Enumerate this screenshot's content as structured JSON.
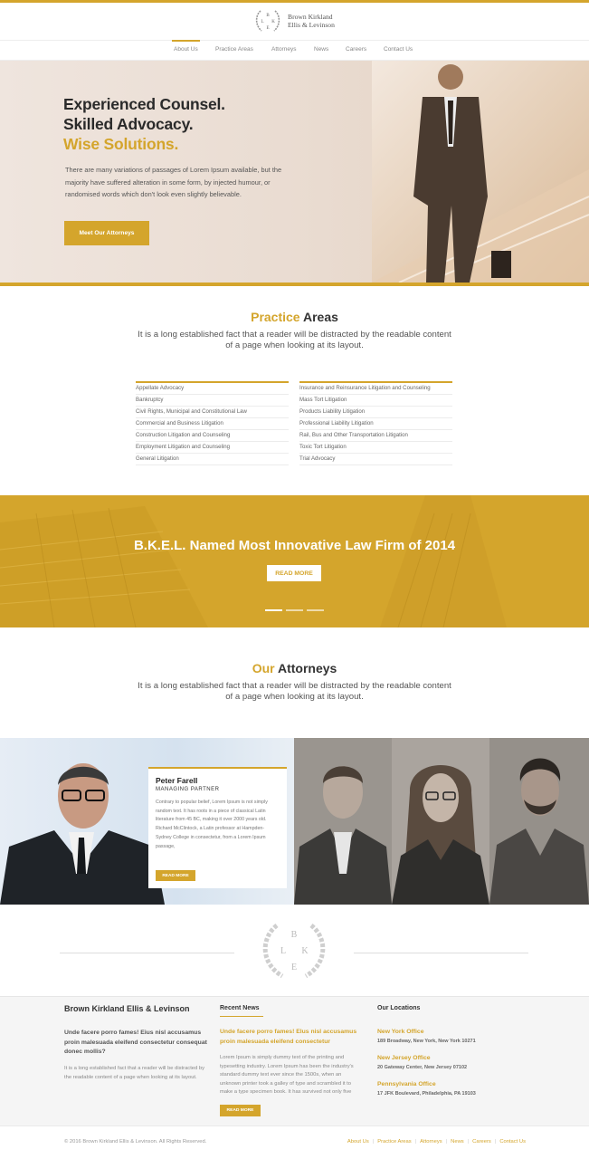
{
  "brand": {
    "name_line1": "Brown Kirkland",
    "name_line2": "Ellis & Levinson",
    "monogram": [
      "B",
      "L",
      "K",
      "E"
    ],
    "accent": "#d4a52c"
  },
  "nav": {
    "items": [
      "About Us",
      "Practice Areas",
      "Attorneys",
      "News",
      "Careers",
      "Contact Us"
    ],
    "active": "About Us"
  },
  "hero": {
    "line1": "Experienced Counsel.",
    "line2": "Skilled Advocacy.",
    "line3": "Wise Solutions.",
    "paragraph": "There are many variations of passages of Lorem Ipsum available, but the majority have suffered alteration in some form, by injected humour, or randomised words which don't look even slightly believable.",
    "button": "Meet Our Attorneys"
  },
  "practice": {
    "title_gold": "Practice",
    "title_rest": "Areas",
    "subtitle": "It is a long established fact that a reader will be distracted by the readable content of a page when looking at its layout.",
    "left": [
      "Appellate Advocacy",
      "Bankruptcy",
      "Civil Rights, Municipal and Constitutional Law",
      "Commercial and Business Litigation",
      "Construction Litigation and Counseling",
      "Employment Litigation and Counseling",
      "General Litigation"
    ],
    "right": [
      "Insurance and Reinsurance Litigation and Counseling",
      "Mass Tort Litigation",
      "Products Liability Litigation",
      "Professional Liability Litigation",
      "Rail, Bus and Other Transportation Litigation",
      "Toxic Tort Litigation",
      "Trial Advocacy"
    ]
  },
  "banner": {
    "title": "B.K.E.L. Named Most Innovative Law Firm of 2014",
    "button": "READ MORE"
  },
  "attorneys": {
    "title_gold": "Our",
    "title_rest": "Attorneys",
    "subtitle": "It is a long established fact that a reader will be distracted by the readable content of a page when looking at its layout.",
    "featured": {
      "name": "Peter Farell",
      "role": "MANAGING PARTNER",
      "bio": "Contrary to popular belief, Lorem Ipsum is not simply random text. It has roots in a piece of classical Latin literature from 45 BC, making it over 2000 years old. Richard McClintock, a Latin professor at Hampden-Sydney College in consectetur, from a Lorem Ipsum passage,",
      "button": "READ MORE"
    }
  },
  "footer": {
    "firm": {
      "heading": "Brown Kirkland Ellis & Levinson",
      "lead": "Unde facere porro fames! Eius nisl accusamus proin malesuada eleifend consectetur consequat donec mollis?",
      "text": "It is a long established fact that a reader will be distracted by the readable content of a page when looking at its layout."
    },
    "news": {
      "heading": "Recent News",
      "headline": "Unde facere porro fames! Elus nisl accusamus proin malesuada eleifend consectetur",
      "text": "Lorem Ipsum is simply dummy text of the printing and typesetting industry. Lorem Ipsum has been the industry's standard dummy text ever since the 1500s, when an unknown printer took a galley of type and scrambled it to make a type specimen book. It has survived not only five",
      "button": "READ MORE"
    },
    "locations": {
      "heading": "Our Locations",
      "items": [
        {
          "name": "New York Office",
          "address": "189 Broadway, New York, New York 10271"
        },
        {
          "name": "New Jersey Office",
          "address": "20 Gateway Center, New Jersey 07102"
        },
        {
          "name": "Pennsylvania Office",
          "address": "17 JFK Boulevard, Philadelphia, PA 19103"
        }
      ]
    }
  },
  "bottom": {
    "copyright": "© 2016 Brown Kirkland Ellis & Levinson. All Rights Reserved.",
    "links": [
      "About Us",
      "Practice Areas",
      "Attorneys",
      "News",
      "Careers",
      "Contact Us"
    ]
  }
}
